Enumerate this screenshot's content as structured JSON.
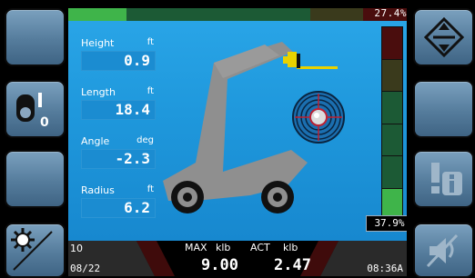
{
  "top": {
    "percent": "27.4%"
  },
  "readouts": [
    {
      "label": "Height",
      "unit": "ft",
      "value": "0.9"
    },
    {
      "label": "Length",
      "unit": "ft",
      "value": "18.4"
    },
    {
      "label": "Angle",
      "unit": "deg",
      "value": "-2.3"
    },
    {
      "label": "Radius",
      "unit": "ft",
      "value": "6.2"
    }
  ],
  "load": {
    "percent": "37.9%"
  },
  "bottom": {
    "left_top": "10",
    "date": "08/22",
    "max_label": "MAX",
    "max_unit": "klb",
    "act_label": "ACT",
    "act_unit": "klb",
    "max_value": "9.00",
    "act_value": "2.47",
    "time": "08:36A"
  },
  "colors": {
    "accent_blue": "#1f98dc",
    "green": "#3fb44a",
    "dark_green": "#1c5a35",
    "olive": "#3a3a1c",
    "dark_red": "#4a0d0d",
    "yellow": "#e9d200"
  }
}
